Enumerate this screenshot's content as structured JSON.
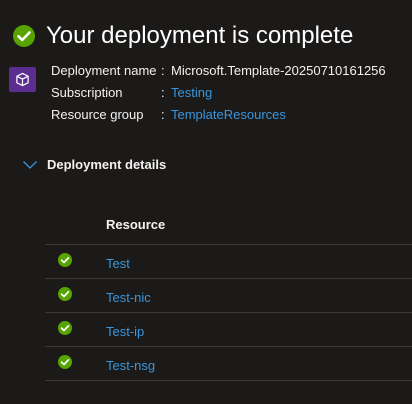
{
  "header": {
    "title": "Your deployment is complete",
    "status_icon": "check-circle-icon",
    "status_color": "#57a300"
  },
  "info": {
    "deployment_name_label": "Deployment name",
    "deployment_name_value": "Microsoft.Template-20250710161256",
    "subscription_label": "Subscription",
    "subscription_value": "Testing",
    "resource_group_label": "Resource group",
    "resource_group_value": "TemplateResources",
    "separator": ":"
  },
  "details": {
    "toggle_label": "Deployment details",
    "column_header": "Resource",
    "rows": [
      {
        "name": "Test"
      },
      {
        "name": "Test-nic"
      },
      {
        "name": "Test-ip"
      },
      {
        "name": "Test-nsg"
      }
    ]
  },
  "colors": {
    "background": "#1b1a19",
    "link": "#3a96dd",
    "deployment_icon_bg": "#5c2d91"
  }
}
